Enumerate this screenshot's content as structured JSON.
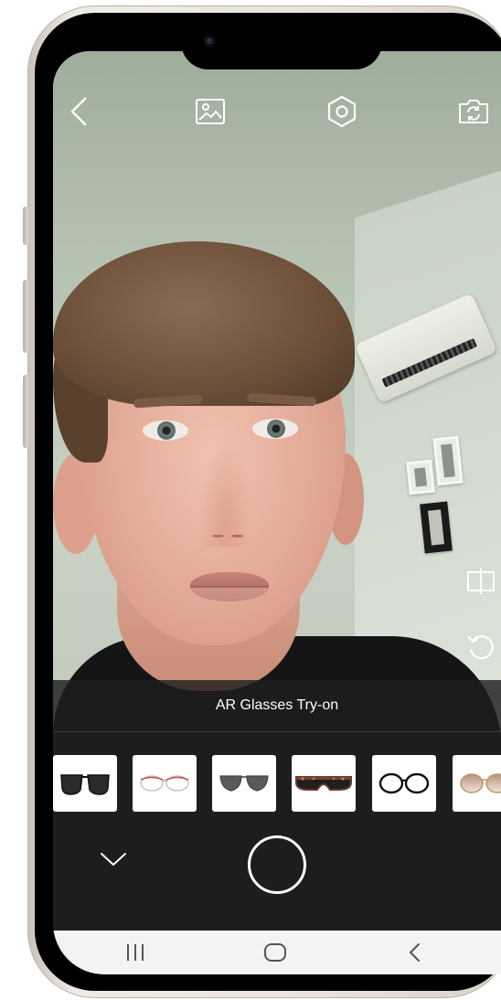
{
  "screen": {
    "title": "AR Glasses Try-on"
  },
  "top_bar": {
    "back_icon": "chevron-left-icon",
    "gallery_icon": "image-icon",
    "settings_icon": "hexagon-settings-icon",
    "switch_camera_icon": "camera-switch-icon"
  },
  "side_tools": {
    "compare_icon": "compare-split-icon",
    "reset_icon": "rotate-reset-icon"
  },
  "glasses": [
    {
      "style": "dark-square-sunglasses",
      "frame": "#1a1a1a",
      "lens": "#2b2b2b"
    },
    {
      "style": "thin-rimless-red",
      "frame": "#c94a4a",
      "lens": "#ffffff"
    },
    {
      "style": "aviator-grey",
      "frame": "#555555",
      "lens": "#5a5a5a"
    },
    {
      "style": "tortoise-shield",
      "frame": "#6b3a2a",
      "lens": "#1f1f1f"
    },
    {
      "style": "black-round-optical",
      "frame": "#111111",
      "lens": "#ffffff"
    },
    {
      "style": "gold-gradient",
      "frame": "#b59a6a",
      "lens": "#c9a69a"
    }
  ],
  "controls": {
    "collapse_icon": "chevron-down-icon",
    "shutter_icon": "shutter-circle-icon"
  },
  "nav": {
    "recent_icon": "recent-apps-icon",
    "home_icon": "home-icon",
    "back_icon": "back-icon"
  },
  "colors": {
    "panel_bg": "#1d1d1d",
    "nav_bg": "#f3f3f3",
    "text": "#ffffff"
  }
}
